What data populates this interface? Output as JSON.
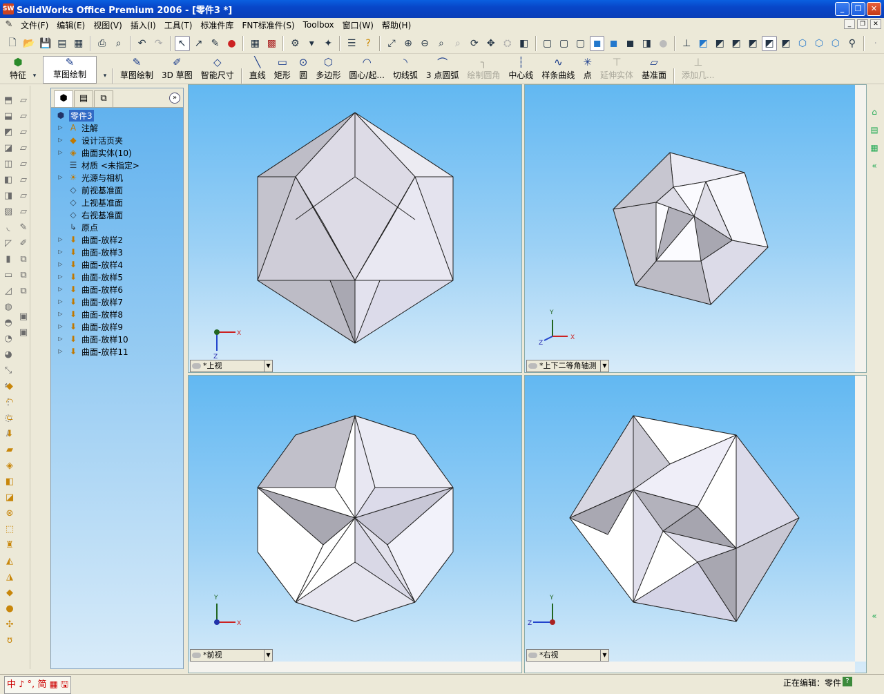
{
  "window": {
    "title": "SolidWorks Office Premium 2006 - [零件3 *]",
    "app_icon": "SW"
  },
  "menu": [
    "文件(F)",
    "编辑(E)",
    "视图(V)",
    "插入(I)",
    "工具(T)",
    "标准件库",
    "FNT标准件(S)",
    "Toolbox",
    "窗口(W)",
    "帮助(H)"
  ],
  "sketch_toolbar": {
    "feature": "特征",
    "sketch_mode": "草图绘制",
    "items": [
      {
        "label": "草图绘制",
        "enabled": true
      },
      {
        "label": "3D 草图",
        "enabled": true
      },
      {
        "label": "智能尺寸",
        "enabled": true
      },
      {
        "label": "直线",
        "enabled": true
      },
      {
        "label": "矩形",
        "enabled": true
      },
      {
        "label": "圆",
        "enabled": true
      },
      {
        "label": "多边形",
        "enabled": true
      },
      {
        "label": "圆心/起...",
        "enabled": true
      },
      {
        "label": "切线弧",
        "enabled": true
      },
      {
        "label": "3 点圆弧",
        "enabled": true
      },
      {
        "label": "绘制圆角",
        "enabled": false
      },
      {
        "label": "中心线",
        "enabled": true
      },
      {
        "label": "样条曲线",
        "enabled": true
      },
      {
        "label": "点",
        "enabled": true
      },
      {
        "label": "延伸实体",
        "enabled": false
      },
      {
        "label": "基准面",
        "enabled": true
      },
      {
        "label": "添加几...",
        "enabled": false
      }
    ]
  },
  "feature_tree": {
    "root": "零件3",
    "items": [
      {
        "label": "注解",
        "icon": "annotation-icon",
        "expand": true
      },
      {
        "label": "设计活页夹",
        "icon": "binder-icon",
        "expand": true
      },
      {
        "label": "曲面实体(10)",
        "icon": "surface-bodies-icon",
        "expand": true
      },
      {
        "label": "材质 <未指定>",
        "icon": "material-icon",
        "expand": false
      },
      {
        "label": "光源与相机",
        "icon": "lights-icon",
        "expand": true
      },
      {
        "label": "前视基准面",
        "icon": "plane-icon",
        "expand": false
      },
      {
        "label": "上视基准面",
        "icon": "plane-icon",
        "expand": false
      },
      {
        "label": "右视基准面",
        "icon": "plane-icon",
        "expand": false
      },
      {
        "label": "原点",
        "icon": "origin-icon",
        "expand": false
      },
      {
        "label": "曲面-放样2",
        "icon": "loft-icon",
        "expand": true
      },
      {
        "label": "曲面-放样3",
        "icon": "loft-icon",
        "expand": true
      },
      {
        "label": "曲面-放样4",
        "icon": "loft-icon",
        "expand": true
      },
      {
        "label": "曲面-放样5",
        "icon": "loft-icon",
        "expand": true
      },
      {
        "label": "曲面-放样6",
        "icon": "loft-icon",
        "expand": true
      },
      {
        "label": "曲面-放样7",
        "icon": "loft-icon",
        "expand": true
      },
      {
        "label": "曲面-放样8",
        "icon": "loft-icon",
        "expand": true
      },
      {
        "label": "曲面-放样9",
        "icon": "loft-icon",
        "expand": true
      },
      {
        "label": "曲面-放样10",
        "icon": "loft-icon",
        "expand": true
      },
      {
        "label": "曲面-放样11",
        "icon": "loft-icon",
        "expand": true
      }
    ]
  },
  "viewports": [
    {
      "label": "*上视",
      "axes": {
        "h": "X",
        "v": "Z"
      }
    },
    {
      "label": "*上下二等角轴测",
      "axes": {
        "h": "X",
        "v": "Y",
        "z": "Z"
      }
    },
    {
      "label": "*前视",
      "axes": {
        "h": "X",
        "v": "Y"
      }
    },
    {
      "label": "*右视",
      "axes": {
        "h": "Z",
        "v": "Y"
      }
    }
  ],
  "status": {
    "editing": "正在编辑：零件",
    "help": "?",
    "ime": "中 ♪ °, 简 ▦ 🖫"
  }
}
